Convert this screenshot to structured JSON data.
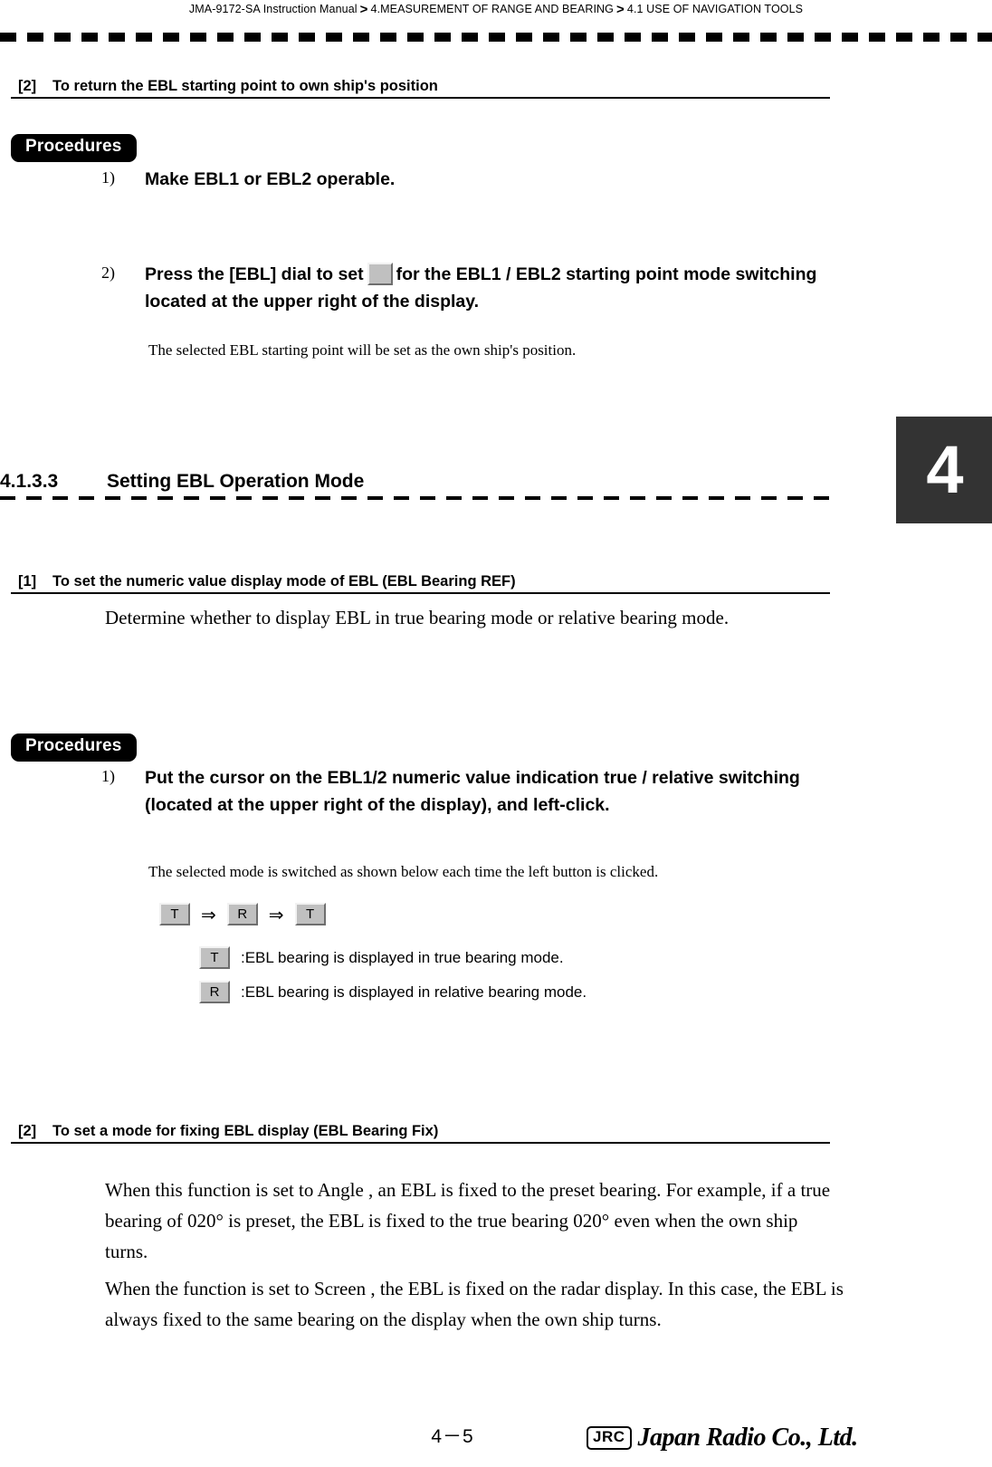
{
  "header": {
    "breadcrumb": [
      "JMA-9172-SA Instruction Manual",
      "4.MEASUREMENT OF RANGE AND BEARING",
      "4.1  USE OF NAVIGATION TOOLS"
    ],
    "separator": ">"
  },
  "chapter_tab": {
    "number": "4",
    "color": "#333333"
  },
  "subsection_a": {
    "marker": "[2]",
    "title": "To return the EBL starting point to own ship's position",
    "procedures_label": "Procedures",
    "steps": [
      {
        "num": "1)",
        "text_before": "Make EBL1 or EBL2 operable.",
        "icon": null,
        "text_after": ""
      },
      {
        "num": "2)",
        "text_before": " Press the [EBL] dial to set",
        "icon": "blank-gray-button-icon",
        "text_after": "for the EBL1 / EBL2 starting point mode switching located at the upper right of the display."
      }
    ],
    "note": "The selected EBL starting point will be set as the own ship's position."
  },
  "section": {
    "number": "4.1.3.3",
    "title": "Setting EBL Operation Mode"
  },
  "subsection_b": {
    "marker": "[1]",
    "title": "To set the numeric value display mode of EBL (EBL Bearing REF)",
    "intro": "Determine whether to display EBL in true bearing mode or relative bearing mode.",
    "procedures_label": "Procedures",
    "steps": [
      {
        "num": "1)",
        "text": "Put the cursor on the EBL1/2 numeric value indication true / relative switching (located at the upper right of the display), and left-click."
      }
    ],
    "note": "The selected mode is switched as shown below each time the left button is clicked.",
    "sequence": {
      "buttons": [
        "T",
        "R",
        "T"
      ],
      "arrow": "⇒"
    },
    "legend": [
      {
        "key": "T",
        "text": ":EBL bearing is displayed in true bearing mode."
      },
      {
        "key": "R",
        "text": ":EBL bearing is displayed in relative bearing mode."
      }
    ]
  },
  "subsection_c": {
    "marker": "[2]",
    "title": "To set a mode for fixing EBL display (EBL Bearing Fix)",
    "paragraphs": [
      "When this function is set to  Angle , an EBL is fixed to the preset bearing. For example, if a true bearing of 020° is preset, the EBL is fixed to the true bearing 020° even when the own ship turns.",
      "When the function is set to  Screen , the EBL is fixed on the radar display. In this case, the EBL is always fixed to the same bearing on the display when the own ship turns."
    ]
  },
  "footer": {
    "page_number": "4－5",
    "logo_mark": "JRC",
    "logo_name": "Japan Radio Co., Ltd."
  }
}
